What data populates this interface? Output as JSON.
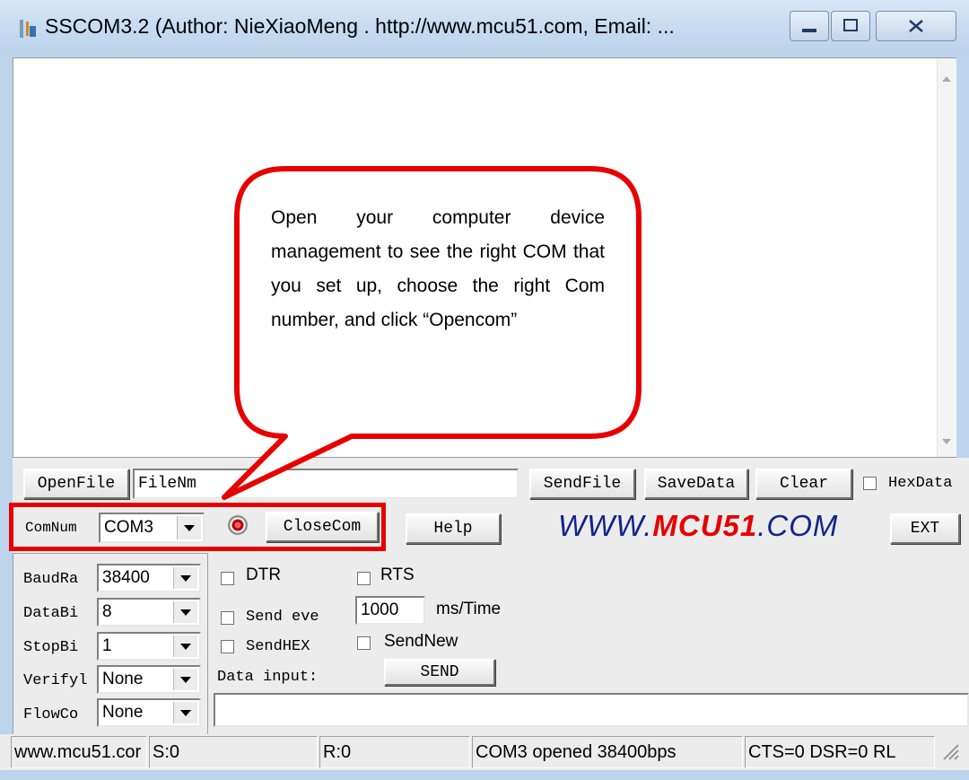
{
  "window": {
    "title": "SSCOM3.2 (Author: NieXiaoMeng .  http://www.mcu51.com,  Email: ...",
    "app_icon": "sscom-app-icon",
    "controls": [
      "minimize-icon",
      "maximize-icon",
      "close-icon"
    ]
  },
  "callout": {
    "text": "Open your computer device management to see the right COM that you set up, choose the right Com number, and click “Opencom”",
    "border_color": "#e80000"
  },
  "file_row": {
    "openfile": "OpenFile",
    "filename": "FileNm",
    "sendfile": "SendFile",
    "savedata": "SaveData",
    "clear": "Clear",
    "hexdata": "HexData"
  },
  "com_row": {
    "comnum_label": "ComNum",
    "com_value": "COM3",
    "closecom": "CloseCom",
    "help": "Help",
    "brand_prefix": "WWW.",
    "brand_highlight": "MCU51",
    "brand_suffix": ".COM",
    "ext": "EXT",
    "highlight_color": "#e80000"
  },
  "settings": {
    "baud_label": "BaudRa",
    "baud_value": "38400",
    "databits_label": "DataBi",
    "databits_value": "8",
    "stopbits_label": "StopBi",
    "stopbits_value": "1",
    "verify_label": "Verifyl",
    "verify_value": "None",
    "flow_label": "FlowCo",
    "flow_value": "None"
  },
  "options": {
    "dtr": "DTR",
    "rts": "RTS",
    "send_every": "Send eve",
    "interval_value": "1000",
    "interval_unit": "ms/Time",
    "sendhex": "SendHEX",
    "sendnew": "SendNew",
    "data_input_label": "Data input:",
    "send_button": "SEND"
  },
  "status": {
    "site": "www.mcu51.cor",
    "sent": "S:0",
    "received": "R:0",
    "port_state": "COM3 opened 38400bps",
    "lines": "CTS=0 DSR=0 RL"
  }
}
